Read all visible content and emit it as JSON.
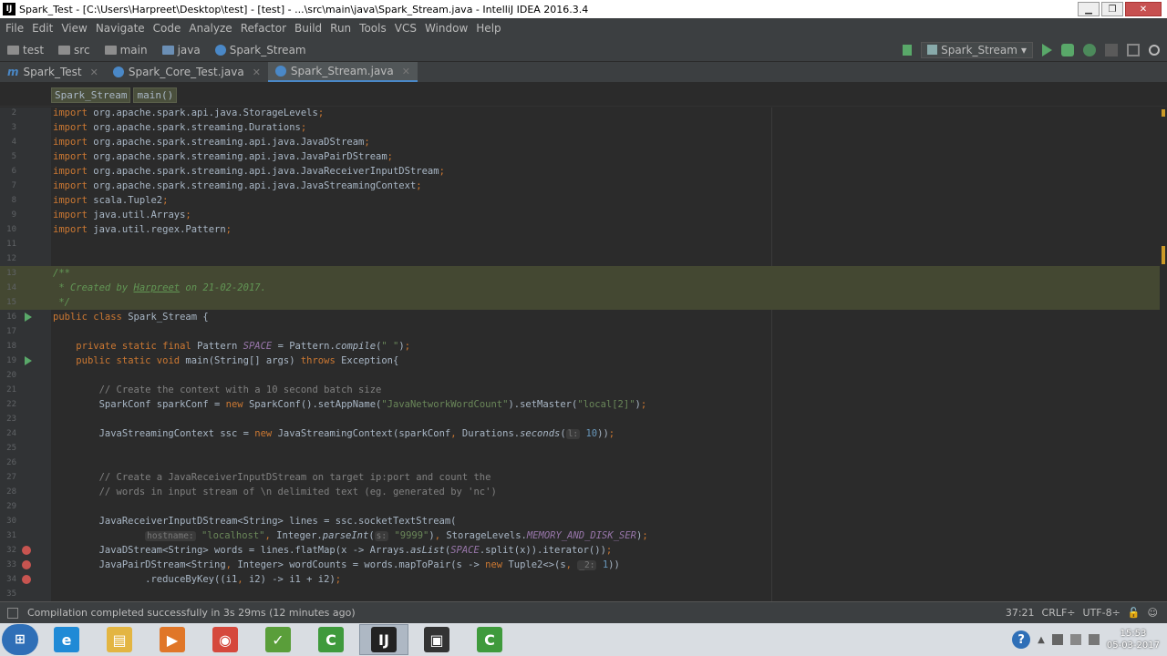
{
  "window": {
    "title": "Spark_Test - [C:\\Users\\Harpreet\\Desktop\\test] - [test] - ...\\src\\main\\java\\Spark_Stream.java - IntelliJ IDEA 2016.3.4",
    "app_icon": "IJ"
  },
  "menu": [
    "File",
    "Edit",
    "View",
    "Navigate",
    "Code",
    "Analyze",
    "Refactor",
    "Build",
    "Run",
    "Tools",
    "VCS",
    "Window",
    "Help"
  ],
  "nav": {
    "crumbs": [
      {
        "label": "test",
        "icon": "module-folder-icon"
      },
      {
        "label": "src",
        "icon": "folder-icon"
      },
      {
        "label": "main",
        "icon": "folder-icon"
      },
      {
        "label": "java",
        "icon": "package-folder-icon"
      },
      {
        "label": "Spark_Stream",
        "icon": "class-icon"
      }
    ],
    "run_config": "Spark_Stream"
  },
  "tabs": [
    {
      "label": "Spark_Test",
      "icon": "module-icon",
      "active": false
    },
    {
      "label": "Spark_Core_Test.java",
      "icon": "class-icon",
      "active": false
    },
    {
      "label": "Spark_Stream.java",
      "icon": "class-icon",
      "active": true
    }
  ],
  "code_breadcrumbs": [
    "Spark_Stream",
    "main()"
  ],
  "editor": {
    "lines": [
      {
        "n": "2",
        "html": "<span class='kw'>import </span>org.apache.spark.api.java.StorageLevels<span class='kw'>;</span>"
      },
      {
        "n": "3",
        "html": "<span class='kw'>import </span>org.apache.spark.streaming.Durations<span class='kw'>;</span>"
      },
      {
        "n": "4",
        "html": "<span class='kw'>import </span>org.apache.spark.streaming.api.java.JavaDStream<span class='kw'>;</span>"
      },
      {
        "n": "5",
        "html": "<span class='kw'>import </span>org.apache.spark.streaming.api.java.JavaPairDStream<span class='kw'>;</span>"
      },
      {
        "n": "6",
        "html": "<span class='kw'>import </span>org.apache.spark.streaming.api.java.JavaReceiverInputDStream<span class='kw'>;</span>"
      },
      {
        "n": "7",
        "html": "<span class='kw'>import </span>org.apache.spark.streaming.api.java.JavaStreamingContext<span class='kw'>;</span>"
      },
      {
        "n": "8",
        "html": "<span class='kw'>import </span>scala.Tuple2<span class='kw'>;</span>"
      },
      {
        "n": "9",
        "html": "<span class='kw'>import </span>java.util.Arrays<span class='kw'>;</span>"
      },
      {
        "n": "10",
        "html": "<span class='kw'>import </span>java.util.regex.Pattern<span class='kw'>;</span>"
      },
      {
        "n": "11",
        "html": ""
      },
      {
        "n": "12",
        "html": ""
      },
      {
        "n": "13",
        "html": "<span class='doc'>/**</span>",
        "hl": true
      },
      {
        "n": "14",
        "html": "<span class='doc'> * Created by </span><span class='docu'>Harpreet</span><span class='doc'> on 21-02-2017.</span>",
        "hl": true
      },
      {
        "n": "15",
        "html": "<span class='doc'> */</span>",
        "hl": true
      },
      {
        "n": "16",
        "html": "<span class='kw'>public class </span>Spark_Stream {",
        "mark": "run"
      },
      {
        "n": "17",
        "html": ""
      },
      {
        "n": "18",
        "html": "    <span class='kw'>private static final </span>Pattern <span class='ital'>SPACE</span> = Pattern.<span class='stat'>compile</span>(<span class='str'>\" \"</span>)<span class='kw'>;</span>"
      },
      {
        "n": "19",
        "html": "    <span class='kw'>public static void </span>main(String[] args) <span class='kw'>throws </span>Exception{",
        "mark": "run"
      },
      {
        "n": "20",
        "html": ""
      },
      {
        "n": "21",
        "html": "        <span class='cm'>// Create the context with a 10 second batch size</span>"
      },
      {
        "n": "22",
        "html": "        SparkConf sparkConf = <span class='kw'>new </span>SparkConf().setAppName(<span class='str'>\"JavaNetworkWordCount\"</span>).setMaster(<span class='str'>\"local[2]\"</span>)<span class='kw'>;</span>"
      },
      {
        "n": "23",
        "html": ""
      },
      {
        "n": "24",
        "html": "        JavaStreamingContext ssc = <span class='kw'>new </span>JavaStreamingContext(sparkConf<span class='kw'>, </span>Durations.<span class='stat'>seconds</span>(<span class='hint'>l:</span> <span class='num'>10</span>))<span class='kw'>;</span>"
      },
      {
        "n": "25",
        "html": ""
      },
      {
        "n": "26",
        "html": ""
      },
      {
        "n": "27",
        "html": "        <span class='cm'>// Create a JavaReceiverInputDStream on target ip:port and count the</span>"
      },
      {
        "n": "28",
        "html": "        <span class='cm'>// words in input stream of \\n delimited text (eg. generated by 'nc')</span>"
      },
      {
        "n": "29",
        "html": ""
      },
      {
        "n": "30",
        "html": "        JavaReceiverInputDStream&lt;String&gt; lines = ssc.socketTextStream("
      },
      {
        "n": "31",
        "html": "                <span class='hint'>hostname:</span> <span class='str'>\"localhost\"</span><span class='kw'>, </span>Integer.<span class='stat'>parseInt</span>(<span class='hint'>s:</span> <span class='str'>\"9999\"</span>)<span class='kw'>, </span>StorageLevels.<span class='ital'>MEMORY_AND_DISK_SER</span>)<span class='kw'>;</span>"
      },
      {
        "n": "32",
        "html": "        JavaDStream&lt;String&gt; words = lines.flatMap(x -&gt; Arrays.<span class='stat'>asList</span>(<span class='ital'>SPACE</span>.split(x)).iterator())<span class='kw'>;</span>",
        "mark": "err"
      },
      {
        "n": "33",
        "html": "        JavaPairDStream&lt;String<span class='kw'>, </span>Integer&gt; wordCounts = words.mapToPair(s -&gt; <span class='kw'>new </span>Tuple2&lt;&gt;(s<span class='kw'>, </span><span class='hint'>_2:</span> <span class='num'>1</span>))",
        "mark": "err"
      },
      {
        "n": "34",
        "html": "                .reduceByKey((i1<span class='kw'>, </span>i2) -&gt; i1 + i2)<span class='kw'>;</span>",
        "mark": "err"
      },
      {
        "n": "35",
        "html": ""
      }
    ]
  },
  "status": {
    "message": "Compilation completed successfully in 3s 29ms (12 minutes ago)",
    "position": "37:21",
    "line_sep": "CRLF÷",
    "encoding": "UTF-8÷"
  },
  "taskbar": {
    "apps": [
      {
        "name": "internet-explorer",
        "glyph": "e",
        "color": "#1f8ad6",
        "active": false
      },
      {
        "name": "file-explorer",
        "glyph": "▤",
        "color": "#e3b542",
        "active": false
      },
      {
        "name": "media-player",
        "glyph": "▶",
        "color": "#e07628",
        "active": false
      },
      {
        "name": "chrome",
        "glyph": "◉",
        "color": "#d5483c",
        "active": false
      },
      {
        "name": "spreadsheet",
        "glyph": "✓",
        "color": "#5a9e3a",
        "active": false
      },
      {
        "name": "camtasia",
        "glyph": "C",
        "color": "#3f9a3c",
        "active": false
      },
      {
        "name": "intellij",
        "glyph": "IJ",
        "color": "#222222",
        "active": true
      },
      {
        "name": "terminal",
        "glyph": "▣",
        "color": "#333333",
        "active": false
      },
      {
        "name": "camtasia-recorder",
        "glyph": "C",
        "color": "#3f9a3c",
        "active": false
      }
    ],
    "time": "15:53",
    "date": "05-03-2017"
  }
}
